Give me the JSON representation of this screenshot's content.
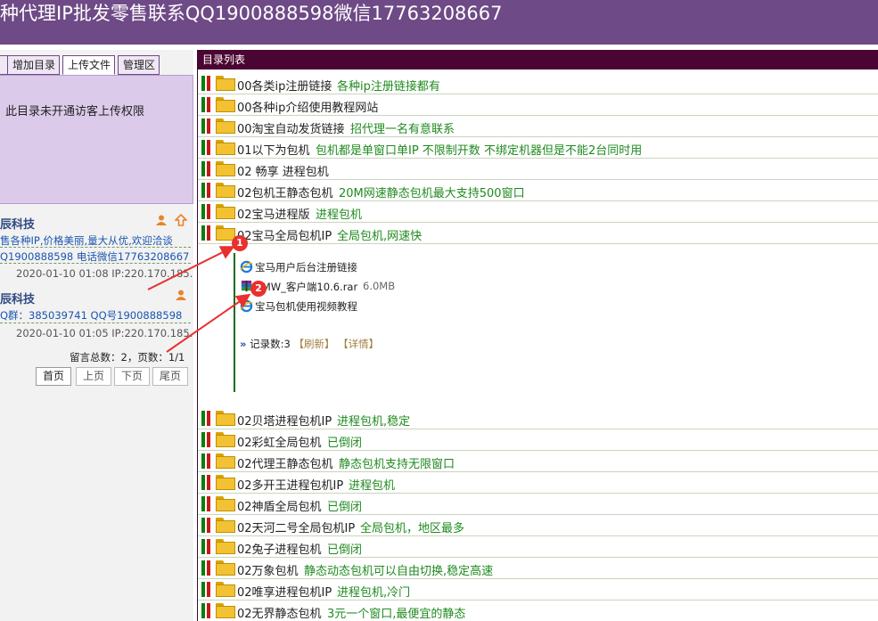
{
  "header": {
    "title": "种代理IP批发零售联系QQ1900888598微信17763208667"
  },
  "left": {
    "tabs": [
      {
        "label": ""
      },
      {
        "label": "增加目录"
      },
      {
        "label": "上传文件"
      },
      {
        "label": "管理区"
      }
    ],
    "upload_message": "此目录未开通访客上传权限",
    "messages": [
      {
        "author": "辰科技",
        "line1": "售各种IP,价格美丽,量大从优,欢迎洽谈",
        "line2": "Q1900888598  电话微信17763208667",
        "time": "2020-01-10 01:08 IP:220.170.185."
      },
      {
        "author": "辰科技",
        "line1": "Q群：385039741  QQ号1900888598",
        "time": "2020-01-10 01:05 IP:220.170.185."
      }
    ],
    "stats": "留言总数：2，页数：1/1",
    "pager": {
      "first": "首页",
      "prev": "上页",
      "next": "下页",
      "last": "尾页"
    }
  },
  "right": {
    "header": "目录列表",
    "folders_top": [
      {
        "name": "00各类ip注册链接",
        "desc": "各种ip注册链接都有"
      },
      {
        "name": "00各种ip介绍使用教程网站",
        "desc": ""
      },
      {
        "name": "00淘宝自动发货链接",
        "desc": "招代理一名有意联系"
      },
      {
        "name": "01以下为包机",
        "desc": "包机都是单窗口单IP 不限制开数 不绑定机器但是不能2台同时用"
      },
      {
        "name": "02 畅享 进程包机",
        "desc": ""
      },
      {
        "name": "02包机王静态包机",
        "desc": "20M网速静态包机最大支持500窗口"
      },
      {
        "name": "02宝马进程版",
        "desc": "进程包机"
      },
      {
        "name": "02宝马全局包机IP",
        "desc": "全局包机,网速快"
      }
    ],
    "expanded_items": [
      {
        "name": "宝马用户后台注册链接",
        "size": "",
        "icon": "ie-link-icon"
      },
      {
        "name": "BMW_客户端10.6.rar",
        "size": "6.0MB",
        "icon": "rar-archive-icon"
      },
      {
        "name": "宝马包机使用视频教程",
        "size": "",
        "icon": "ie-link-icon"
      }
    ],
    "record": {
      "arrows": "»",
      "count": "记录数:3",
      "refresh": "【刷新】",
      "detail": "【详情】"
    },
    "folders_bottom": [
      {
        "name": "02贝塔进程包机IP",
        "desc": "进程包机,稳定"
      },
      {
        "name": "02彩虹全局包机",
        "desc": "已倒闭"
      },
      {
        "name": "02代理王静态包机",
        "desc": "静态包机支持无限窗口"
      },
      {
        "name": "02多开王进程包机IP",
        "desc": "进程包机"
      },
      {
        "name": "02神盾全局包机",
        "desc": "已倒闭"
      },
      {
        "name": "02天河二号全局包机IP",
        "desc": "全局包机，地区最多"
      },
      {
        "name": "02兔子进程包机",
        "desc": "已倒闭"
      },
      {
        "name": "02万象包机",
        "desc": "静态动态包机可以自由切换,稳定高速"
      },
      {
        "name": "02唯享进程包机IP",
        "desc": "进程包机,冷门"
      },
      {
        "name": "02无界静态包机",
        "desc": "3元一个窗口,最便宜的静态"
      }
    ],
    "annotations": [
      "1",
      "2"
    ]
  },
  "colors": {
    "header": "#6e4a86",
    "list_header": "#4a0532",
    "desc_green": "#1f8a1f",
    "annot_red": "#e8302e"
  }
}
